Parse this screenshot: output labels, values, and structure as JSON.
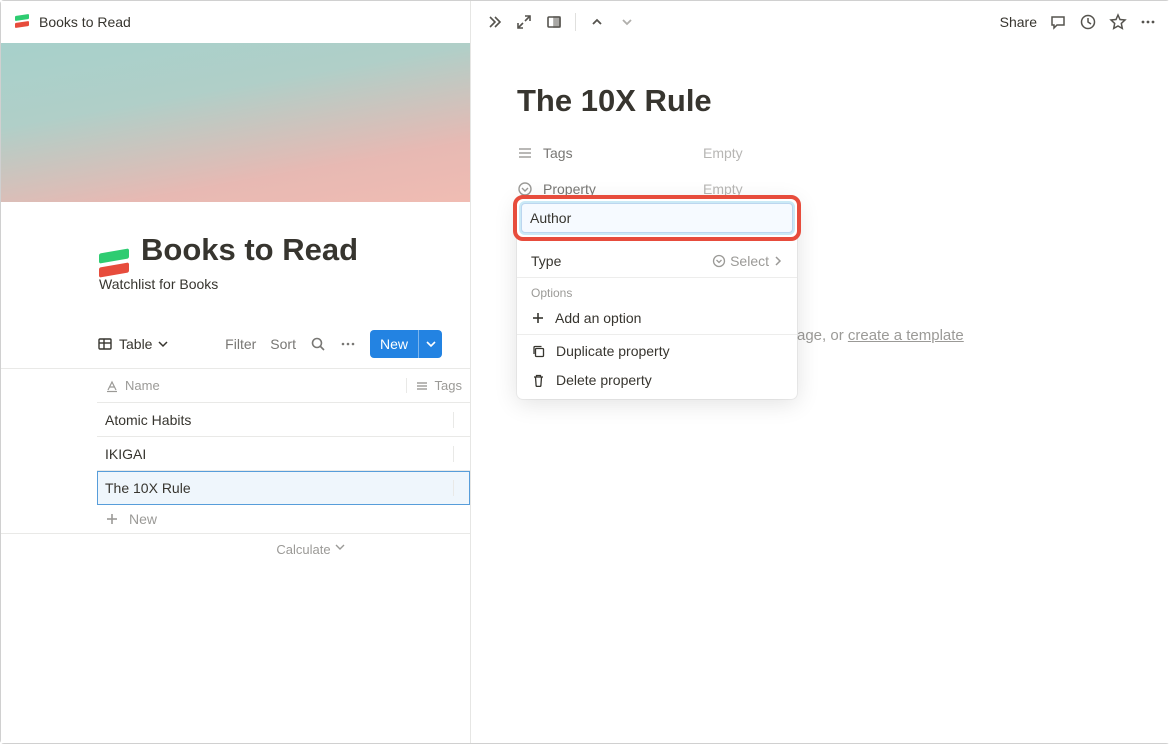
{
  "left": {
    "breadcrumb": "Books to Read",
    "title": "Books to Read",
    "subtitle": "Watchlist for Books",
    "toolbar": {
      "view_label": "Table",
      "filter": "Filter",
      "sort": "Sort",
      "new_label": "New"
    },
    "table": {
      "columns": [
        "Name",
        "Tags"
      ],
      "rows": [
        {
          "name": "Atomic Habits",
          "tags": ""
        },
        {
          "name": "IKIGAI",
          "tags": ""
        },
        {
          "name": "The 10X Rule",
          "tags": "",
          "selected": true
        }
      ],
      "new_row_label": "New",
      "calculate_label": "Calculate"
    }
  },
  "right": {
    "topbar": {
      "share": "Share"
    },
    "title": "The 10X Rule",
    "properties": [
      {
        "icon": "list",
        "name": "Tags",
        "value": "Empty"
      },
      {
        "icon": "select",
        "name": "Property",
        "value": "Empty"
      }
    ],
    "body_hint_suffix": "age, or ",
    "body_hint_link": "create a template"
  },
  "popup": {
    "field_value": "Author",
    "type_label": "Type",
    "type_value": "Select",
    "options_label": "Options",
    "add_option_label": "Add an option",
    "duplicate_label": "Duplicate property",
    "delete_label": "Delete property"
  }
}
